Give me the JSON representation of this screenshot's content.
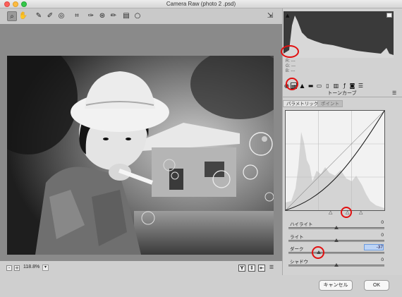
{
  "window": {
    "title": "Camera Raw (photo 2 .psd)"
  },
  "toolbar": {
    "tools": [
      "zoom-icon",
      "hand-icon",
      "white-balance-icon",
      "color-sampler-icon",
      "target-adjust-icon",
      "crop-icon",
      "spot-removal-icon",
      "red-eye-icon",
      "brush-icon",
      "graduated-filter-icon",
      "radial-filter-icon"
    ],
    "open_icon": "open-preferences-icon"
  },
  "histogram": {
    "r_label": "R:",
    "g_label": "G:",
    "b_label": "B:",
    "r_value": "---",
    "g_value": "---",
    "b_value": "---"
  },
  "statusbar": {
    "zoom_out": "-",
    "zoom_in": "+",
    "zoom": "118.8%",
    "zoom_dropdown": "▾",
    "view_y": "Y"
  },
  "panel": {
    "section_title": "トーンカーブ",
    "tab_parametric": "パラメトリック",
    "tab_point": "ポイント",
    "sliders": [
      {
        "label": "ハイライト",
        "value": "0"
      },
      {
        "label": "ライト",
        "value": "0"
      },
      {
        "label": "ダーク",
        "value": "-37"
      },
      {
        "label": "シャドウ",
        "value": "0"
      }
    ]
  },
  "buttons": {
    "cancel": "キャンセル",
    "ok": "OK"
  },
  "colors": {
    "highlight_ring": "#e11010",
    "value_highlight": "#bcd3f5"
  }
}
